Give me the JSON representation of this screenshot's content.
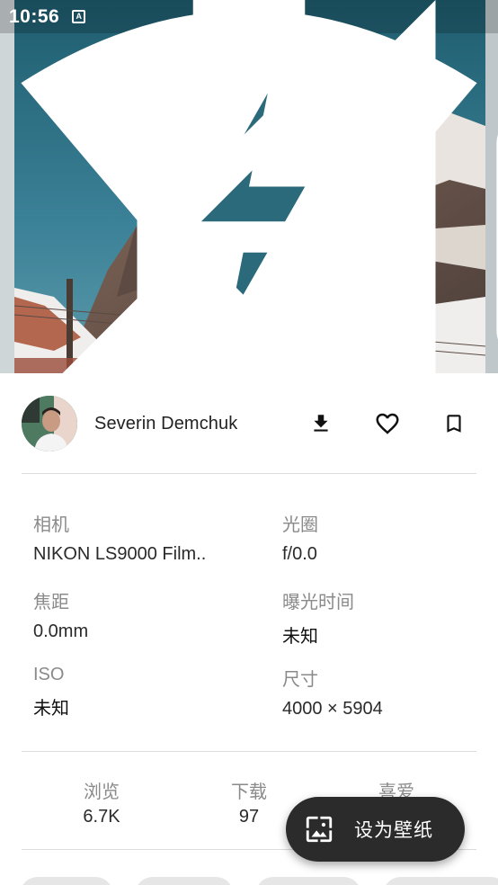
{
  "status_bar": {
    "time": "10:56",
    "app_badge": "A"
  },
  "toolbar": {
    "back_icon": "arrow-back-icon",
    "open_icon": "open-in-browser-icon",
    "more_icon": "more-vert-icon"
  },
  "photo": {
    "subject": "mountain"
  },
  "author": {
    "name": "Severin Demchuk"
  },
  "actions": {
    "download_icon": "download-icon",
    "like_icon": "heart-outline-icon",
    "bookmark_icon": "bookmark-outline-icon"
  },
  "exif": {
    "camera_label": "相机",
    "camera_value": "NIKON LS9000 Film..",
    "aperture_label": "光圈",
    "aperture_value": "f/0.0",
    "focal_label": "焦距",
    "focal_value": "0.0mm",
    "exposure_label": "曝光时间",
    "exposure_value": "未知",
    "iso_label": "ISO",
    "iso_value": "未知",
    "size_label": "尺寸",
    "size_value": "4000 × 5904"
  },
  "stats": {
    "views_label": "浏览",
    "views_value": "6.7K",
    "downloads_label": "下载",
    "downloads_value": "97",
    "likes_label": "喜爱"
  },
  "fab": {
    "label": "设为壁纸",
    "icon": "wallpaper-icon"
  },
  "colors": {
    "fab_bg": "#2b2b2b",
    "divider": "#dcdcdc",
    "label_gray": "#8a8a8a"
  }
}
